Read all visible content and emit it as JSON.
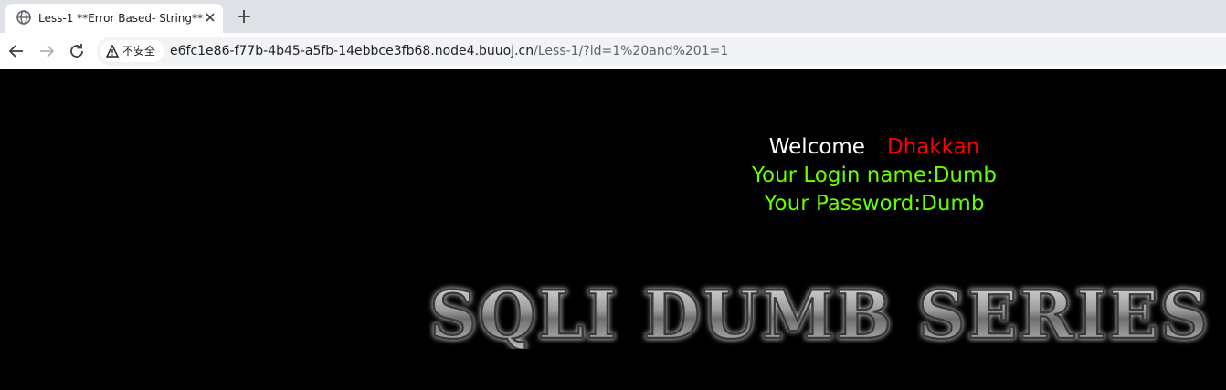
{
  "browser": {
    "tab": {
      "title": "Less-1 **Error Based- String**",
      "favicon": "globe-icon",
      "close": "close-icon"
    },
    "new_tab": "plus-icon",
    "nav": {
      "back": "arrow-left-icon",
      "forward": "arrow-right-icon",
      "reload": "reload-icon"
    },
    "security": {
      "icon": "warning-triangle-icon",
      "label": "不安全"
    },
    "url": {
      "host": "e6fc1e86-f77b-4b45-a5fb-14ebbce3fb68.node4.buuoj.cn",
      "path": "/Less-1/?id=1%20and%201=1"
    }
  },
  "page": {
    "background": "#000000",
    "welcome_word": "Welcome",
    "welcome_name": "Dhakkan",
    "login_line": "Your Login name:Dumb",
    "password_line": "Your Password:Dumb",
    "colors": {
      "welcome": "#ffffff",
      "name": "#ff0000",
      "info": "#66ff00"
    },
    "banner_text": "SQLI DUMB SERIES"
  }
}
